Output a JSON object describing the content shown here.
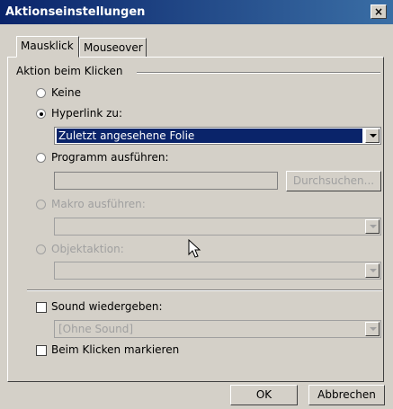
{
  "window": {
    "title": "Aktionseinstellungen",
    "close_glyph": "×"
  },
  "tabs": [
    {
      "label": "Mausklick",
      "active": true
    },
    {
      "label": "Mouseover",
      "active": false
    }
  ],
  "group": {
    "title": "Aktion beim Klicken",
    "options": {
      "none": "Keine",
      "hyperlink": "Hyperlink zu:",
      "program": "Programm ausführen:",
      "macro": "Makro ausführen:",
      "object_action": "Objektaktion:"
    },
    "selected_option": "hyperlink",
    "hyperlink_value": "Zuletzt angesehene Folie",
    "program_value": "",
    "browse_label": "Durchsuchen...",
    "macro_value": "",
    "object_action_value": ""
  },
  "sound": {
    "label": "Sound wiedergeben:",
    "checked": false,
    "value": "[Ohne Sound]"
  },
  "highlight": {
    "label": "Beim Klicken markieren",
    "checked": false
  },
  "footer": {
    "ok_label": "OK",
    "cancel_label": "Abbrechen"
  },
  "icons": {
    "cursor": "arrow-pointer-icon",
    "close": "close-icon",
    "dropdown": "chevron-down-icon"
  }
}
